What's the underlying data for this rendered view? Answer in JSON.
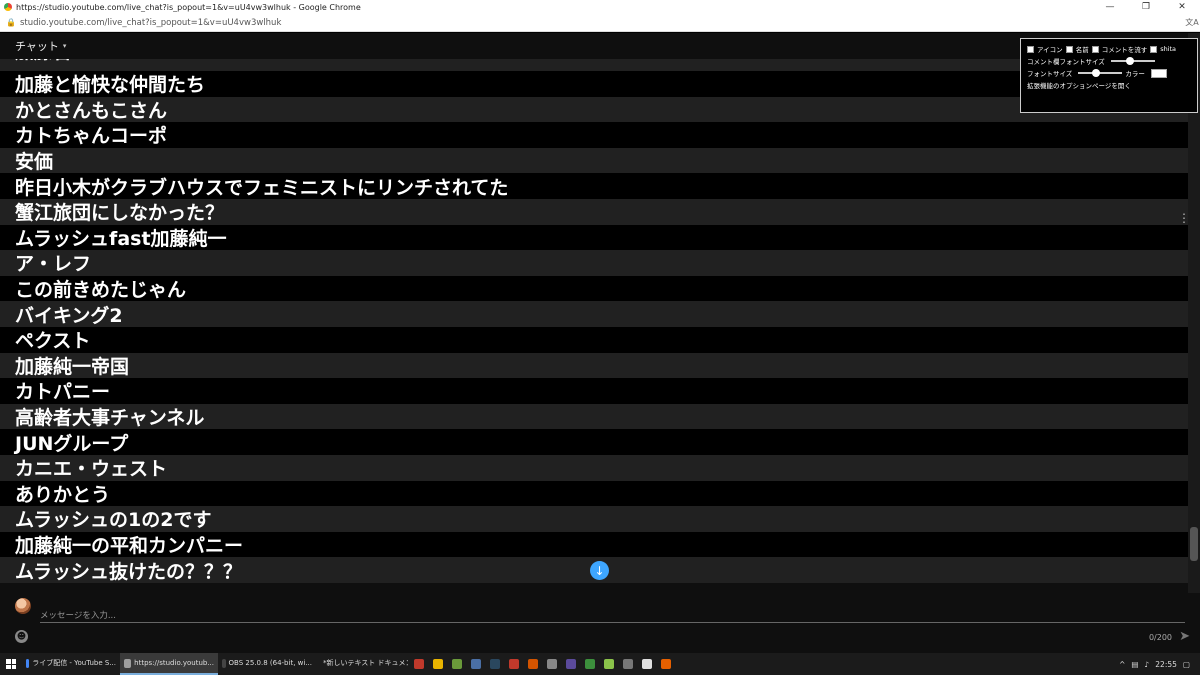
{
  "window": {
    "title": "https://studio.youtube.com/live_chat?is_popout=1&v=uU4vw3wlhuk - Google Chrome",
    "minimize_glyph": "—",
    "restore_glyph": "❐",
    "close_glyph": "✕"
  },
  "address_bar": {
    "url": "studio.youtube.com/live_chat?is_popout=1&v=uU4vw3wlhuk",
    "lock_icon": "lock-icon",
    "translate_icon": "translate-icon"
  },
  "chat": {
    "header_label": "チャット",
    "caret": "▾",
    "messages": [
      "加藤曾",
      "加藤と愉快な仲間たち",
      "かとさんもこさん",
      "カトちゃんコーポ",
      "安価",
      "昨日小木がクラブハウスでフェミニストにリンチされてた",
      "蟹江旅団にしなかった？",
      "ムラッシュfast加藤純一",
      "ア・レフ",
      "この前きめたじゃん",
      "バイキング2",
      "ペクスト",
      "加藤純一帝国",
      "カトパニー",
      "高齢者大事チャンネル",
      "JUNグループ",
      "カニエ・ウェスト",
      "ありかとう",
      "ムラッシュの1の2です",
      "加藤純一の平和カンパニー",
      "ムラッシュ抜けたの？？？"
    ],
    "row_menu_glyph": "⋮",
    "jump_down_glyph": "↓",
    "input_placeholder": "メッセージを入力...",
    "char_counter": "0/200",
    "send_glyph": "➤",
    "emoji_glyph": "☻"
  },
  "extension_popup": {
    "checkbox_icon": "アイコン",
    "checkbox_name": "名前",
    "checkbox_flow": "コメントを流す",
    "checkbox_shita": "shita",
    "comment_font_size_label": "コメント欄フォントサイズ",
    "comment_font_size_level": 0.35,
    "font_size_label": "フォントサイズ",
    "font_size_level": 0.3,
    "color_label": "カラー",
    "color_value": "#ffffff",
    "options_link": "拡張機能のオプションページを開く"
  },
  "taskbar": {
    "tasks": [
      {
        "label": "ライブ配信 - YouTube S...",
        "icon": "chrome-icon",
        "active": false
      },
      {
        "label": "https://studio.youtub...",
        "icon": "chrome-window-icon",
        "active": true
      },
      {
        "label": "OBS 25.0.8 (64-bit, wi...",
        "icon": "obs-icon",
        "active": false
      },
      {
        "label": "*新しいテキスト ドキュメン...",
        "icon": "notepad-icon",
        "active": false
      }
    ],
    "clock": "22:55",
    "tray_caret": "^"
  },
  "colors": {
    "chat_background": "#0f0f0f",
    "row_dark": "#000000",
    "row_gray": "#212121",
    "accent_blue": "#3ea6ff"
  }
}
